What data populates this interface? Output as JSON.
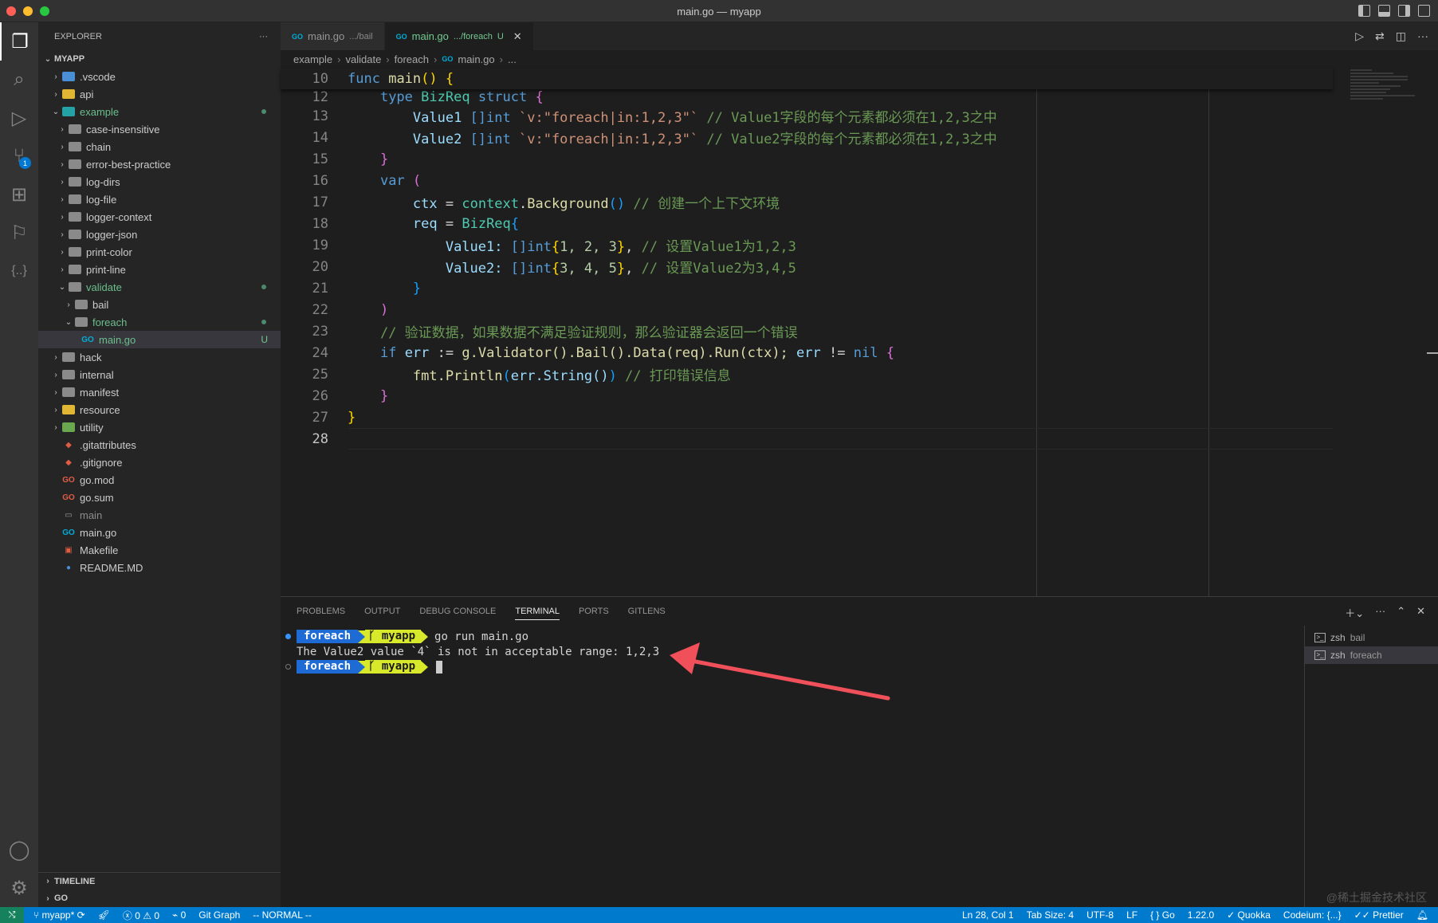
{
  "window": {
    "title": "main.go — myapp"
  },
  "activity_bar": {
    "scm_badge": "1"
  },
  "explorer": {
    "header": "EXPLORER",
    "more": "···",
    "root": "MYAPP",
    "items": [
      {
        "label": ".vscode"
      },
      {
        "label": "api"
      },
      {
        "label": "example"
      },
      {
        "label": "case-insensitive"
      },
      {
        "label": "chain"
      },
      {
        "label": "error-best-practice"
      },
      {
        "label": "log-dirs"
      },
      {
        "label": "log-file"
      },
      {
        "label": "logger-context"
      },
      {
        "label": "logger-json"
      },
      {
        "label": "print-color"
      },
      {
        "label": "print-line"
      },
      {
        "label": "validate"
      },
      {
        "label": "bail"
      },
      {
        "label": "foreach"
      },
      {
        "label": "main.go",
        "status": "U"
      },
      {
        "label": "hack"
      },
      {
        "label": "internal"
      },
      {
        "label": "manifest"
      },
      {
        "label": "resource"
      },
      {
        "label": "utility"
      },
      {
        "label": ".gitattributes"
      },
      {
        "label": ".gitignore"
      },
      {
        "label": "go.mod"
      },
      {
        "label": "go.sum"
      },
      {
        "label": "main"
      },
      {
        "label": "main.go"
      },
      {
        "label": "Makefile"
      },
      {
        "label": "README.MD"
      }
    ],
    "timeline": "TIMELINE",
    "go": "GO"
  },
  "tabs": [
    {
      "name": "main.go",
      "path": ".../bail"
    },
    {
      "name": "main.go",
      "path": ".../foreach",
      "status": "U"
    }
  ],
  "breadcrumb": [
    "example",
    "validate",
    "foreach",
    "main.go",
    "..."
  ],
  "code": {
    "line_numbers": [
      "10",
      "12",
      "13",
      "14",
      "15",
      "16",
      "17",
      "18",
      "19",
      "20",
      "21",
      "22",
      "23",
      "24",
      "25",
      "26",
      "27",
      "28"
    ],
    "l10_a": "func",
    "l10_b": "main",
    "l10_c": "()",
    "l10_d": "{",
    "l12_a": "type",
    "l12_b": "BizReq",
    "l12_c": "struct",
    "l12_d": "{",
    "l13_a": "Value1",
    "l13_b": "[]int",
    "l13_c": "`v:\"foreach|in:1,2,3\"`",
    "l13_d": "// Value1字段的每个元素都必须在1,2,3之中",
    "l14_a": "Value2",
    "l14_b": "[]int",
    "l14_c": "`v:\"foreach|in:1,2,3\"`",
    "l14_d": "// Value2字段的每个元素都必须在1,2,3之中",
    "l15": "}",
    "l16_a": "var",
    "l16_b": "(",
    "l17_a": "ctx",
    "l17_b": "=",
    "l17_c": "context",
    "l17_d": ".",
    "l17_e": "Background",
    "l17_f": "()",
    "l17_g": "// 创建一个上下文环境",
    "l18_a": "req",
    "l18_b": "=",
    "l18_c": "BizReq",
    "l18_d": "{",
    "l19_a": "Value1:",
    "l19_b": "[]int",
    "l19_c": "{",
    "l19_d": "1, 2, 3",
    "l19_e": "}",
    "l19_f": ",",
    "l19_g": "// 设置Value1为1,2,3",
    "l20_a": "Value2:",
    "l20_b": "[]int",
    "l20_c": "{",
    "l20_d": "3, 4, 5",
    "l20_e": "}",
    "l20_f": ",",
    "l20_g": "// 设置Value2为3,4,5",
    "l21": "}",
    "l22": ")",
    "l23": "// 验证数据，如果数据不满足验证规则，那么验证器会返回一个错误",
    "l24_a": "if",
    "l24_b": "err",
    "l24_c": ":=",
    "l24_d": "g.Validator().Bail().Data(req).Run(ctx);",
    "l24_e": "err",
    "l24_f": "!=",
    "l24_g": "nil",
    "l24_h": "{",
    "l25_a": "fmt.Println",
    "l25_b": "(",
    "l25_c": "err.String()",
    "l25_d": ")",
    "l25_e": "// 打印错误信息",
    "l26": "}",
    "l27": "}"
  },
  "panel": {
    "tabs": [
      "PROBLEMS",
      "OUTPUT",
      "DEBUG CONSOLE",
      "TERMINAL",
      "PORTS",
      "GITLENS"
    ],
    "terminal": {
      "prompt_dir": "foreach",
      "prompt_repo": "myapp",
      "command": "go run main.go",
      "output": "The Value2 value `4` is not in acceptable range: 1,2,3"
    },
    "terminals": [
      {
        "shell": "zsh",
        "name": "bail"
      },
      {
        "shell": "zsh",
        "name": "foreach"
      }
    ]
  },
  "watermark": "@稀土掘金技术社区",
  "statusbar": {
    "branch": "myapp*",
    "errors": "0",
    "warnings": "0",
    "ports": "0",
    "git_graph": "Git Graph",
    "vim_mode": "-- NORMAL --",
    "position": "Ln 28, Col 1",
    "tab_size": "Tab Size: 4",
    "encoding": "UTF-8",
    "eol": "LF",
    "language": "Go",
    "go_version": "1.22.0",
    "quokka": "Quokka",
    "codeium": "Codeium: {...}",
    "prettier": "Prettier"
  },
  "colors": {
    "accent": "#007acc",
    "annotation_arrow": "#f0505a",
    "prompt_blue": "#1f6bd6",
    "prompt_yellow": "#d8e82a"
  }
}
